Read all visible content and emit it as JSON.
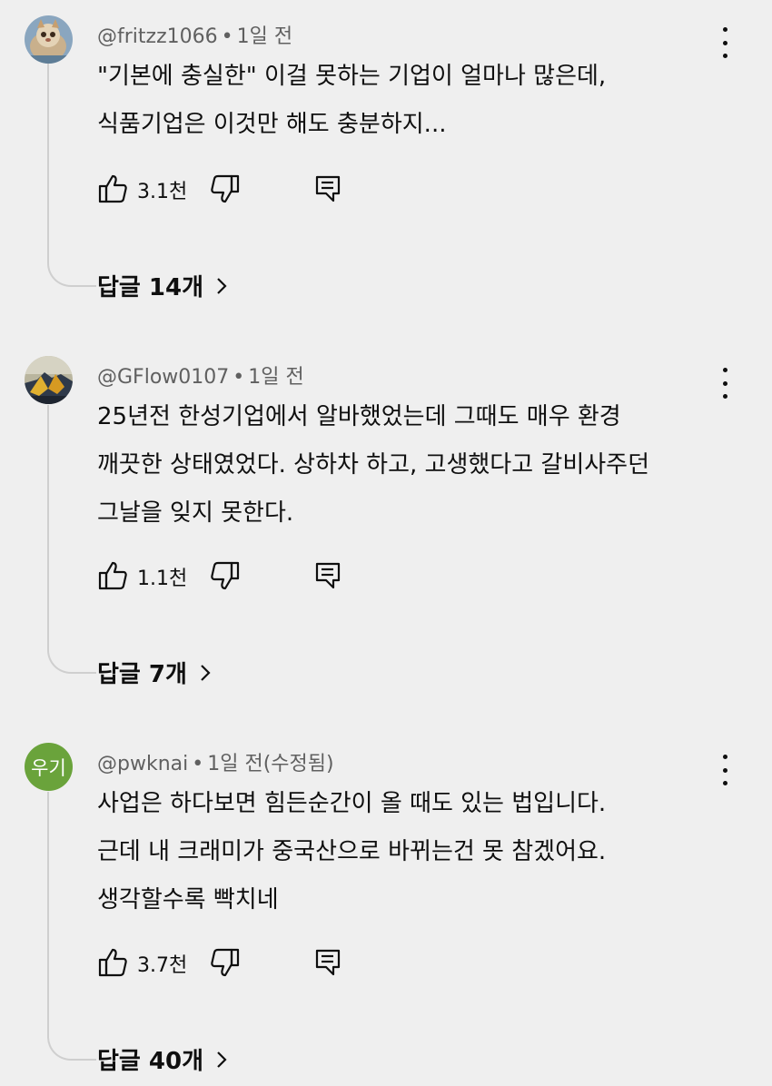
{
  "comments": [
    {
      "handle": "@fritzz1066",
      "time": "1일 전",
      "lines": [
        "\"기본에 충실한\" 이걸 못하는 기업이 얼마나 많은데,",
        "식품기업은 이것만 해도 충분하지..."
      ],
      "likes": "3.1천",
      "replies": "답글 14개"
    },
    {
      "handle": "@GFlow0107",
      "time": "1일 전",
      "lines": [
        "25년전 한성기업에서 알바했었는데 그때도 매우 환경",
        "깨끗한 상태였었다. 상하차 하고, 고생했다고 갈비사주던",
        "그날을 잊지 못한다."
      ],
      "likes": "1.1천",
      "replies": "답글 7개"
    },
    {
      "handle": "@pwknai",
      "time": "1일 전(수정됨)",
      "avatar_text": "우기",
      "avatar_color": "#6aa33b",
      "lines": [
        "사업은 하다보면 힘든순간이 올 때도 있는 법입니다.",
        "근데 내 크래미가 중국산으로 바뀌는건 못 참겠어요.",
        "생각할수록 빡치네"
      ],
      "likes": "3.7천",
      "replies": "답글 40개"
    }
  ],
  "separator": "•",
  "icons": {
    "like": "thumbs-up-icon",
    "dislike": "thumbs-down-icon",
    "reply": "reply-icon",
    "more": "more-vert-icon",
    "chevron": "chevron-right-icon"
  }
}
